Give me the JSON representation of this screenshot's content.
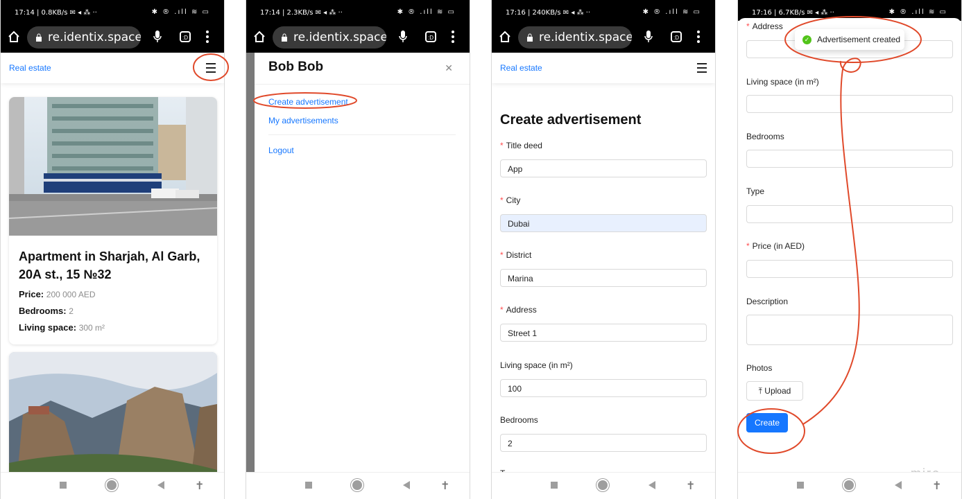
{
  "colors": {
    "accent": "#1677ff",
    "annotation": "#e0492a",
    "required": "#ff4d4f",
    "success": "#52c41a"
  },
  "phones": [
    {
      "status": {
        "time": "17:14 | 0.8KB/s ✉ ◂ ⁂ ··",
        "icons": "✱ ® .ıll ≋ ▭"
      },
      "url": "re.identix.space",
      "header_brand": "Real estate",
      "listing": {
        "title": "Apartment in Sharjah, Al Garb, 20A st., 15 №32",
        "price_label": "Price:",
        "price": "200 000 AED",
        "bedrooms_label": "Bedrooms:",
        "bedrooms": "2",
        "living_label": "Living space:",
        "living": "300 m²"
      }
    },
    {
      "status": {
        "time": "17:14 | 2.3KB/s ✉ ◂ ⁂ ··",
        "icons": "✱ ® .ıll ≋ ▭"
      },
      "url": "re.identix.space/a",
      "drawer": {
        "user": "Bob Bob",
        "close_icon": "close-icon",
        "items": [
          "Create advertisement",
          "My advertisements",
          "Logout"
        ]
      }
    },
    {
      "status": {
        "time": "17:16 | 240KB/s ✉ ◂ ⁂ ··",
        "icons": "✱ ® .ıll ≋ ▭"
      },
      "url": "re.identix.space/c",
      "header_brand": "Real estate",
      "form": {
        "title": "Create advertisement",
        "fields": [
          {
            "label": "Title deed",
            "required": true,
            "value": "App"
          },
          {
            "label": "City",
            "required": true,
            "value": "Dubai"
          },
          {
            "label": "District",
            "required": true,
            "value": "Marina"
          },
          {
            "label": "Address",
            "required": true,
            "value": "Street 1"
          },
          {
            "label": "Living space (in m²)",
            "required": false,
            "value": "100"
          },
          {
            "label": "Bedrooms",
            "required": false,
            "value": "2"
          }
        ],
        "partial_label": "T"
      }
    },
    {
      "status": {
        "time": "17:16 | 6.7KB/s ✉ ◂ ⁂ ··",
        "icons": "✱ ® .ıll ≋ ▭"
      },
      "form": {
        "fields": [
          {
            "label": "Address",
            "required": true,
            "value": ""
          },
          {
            "label": "Living space (in m²)",
            "required": false,
            "value": ""
          },
          {
            "label": "Bedrooms",
            "required": false,
            "value": ""
          },
          {
            "label": "Type",
            "required": false,
            "value": ""
          },
          {
            "label": "Price (in AED)",
            "required": true,
            "value": ""
          },
          {
            "label": "Description",
            "required": false,
            "value": ""
          }
        ],
        "photos_label": "Photos",
        "upload_label": "Upload",
        "create_label": "Create"
      },
      "toast": "Advertisement created"
    }
  ],
  "watermark": "miro"
}
